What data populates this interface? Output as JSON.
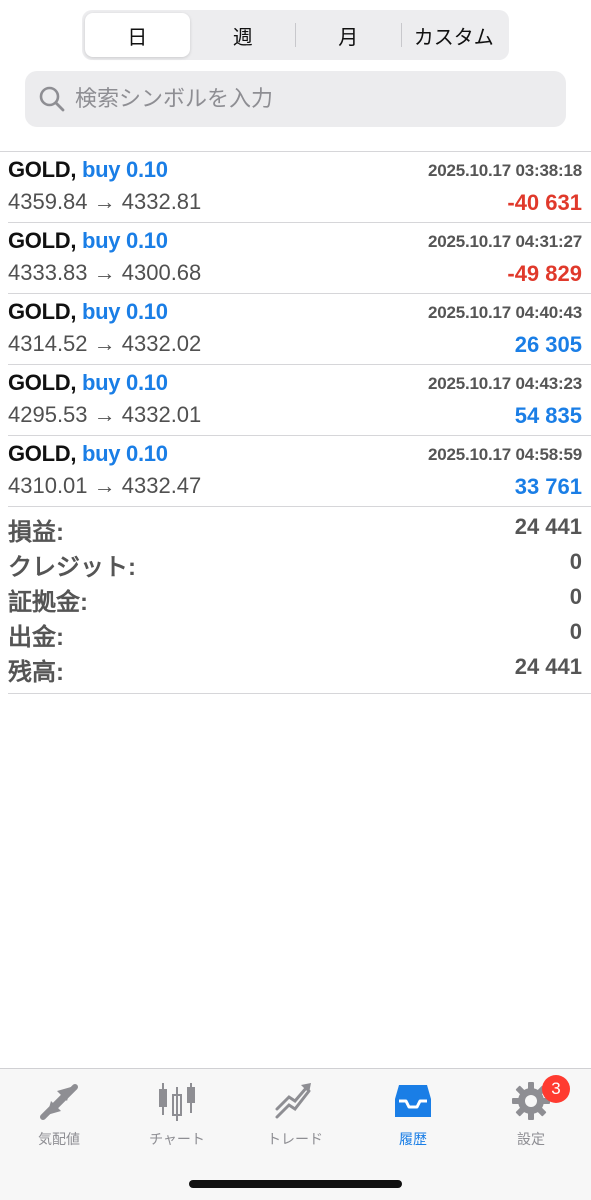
{
  "period_tabs": [
    "日",
    "週",
    "月",
    "カスタム"
  ],
  "active_period": "日",
  "search": {
    "placeholder": "検索シンボルを入力"
  },
  "deals": [
    {
      "symbol": "GOLD,",
      "side": "buy 0.10",
      "time": "2025.10.17 03:38:18",
      "prices": "4359.84 → 4332.81",
      "profit": "-40 631",
      "profit_sign": "neg"
    },
    {
      "symbol": "GOLD,",
      "side": "buy 0.10",
      "time": "2025.10.17 04:31:27",
      "prices": "4333.83 → 4300.68",
      "profit": "-49 829",
      "profit_sign": "neg"
    },
    {
      "symbol": "GOLD,",
      "side": "buy 0.10",
      "time": "2025.10.17 04:40:43",
      "prices": "4314.52 → 4332.02",
      "profit": "26 305",
      "profit_sign": "pos"
    },
    {
      "symbol": "GOLD,",
      "side": "buy 0.10",
      "time": "2025.10.17 04:43:23",
      "prices": "4295.53 → 4332.01",
      "profit": "54 835",
      "profit_sign": "pos"
    },
    {
      "symbol": "GOLD,",
      "side": "buy 0.10",
      "time": "2025.10.17 04:58:59",
      "prices": "4310.01 → 4332.47",
      "profit": "33 761",
      "profit_sign": "pos"
    }
  ],
  "summary": [
    {
      "label": "損益:",
      "value": "24 441"
    },
    {
      "label": "クレジット:",
      "value": "0"
    },
    {
      "label": "証拠金:",
      "value": "0"
    },
    {
      "label": "出金:",
      "value": "0"
    },
    {
      "label": "残高:",
      "value": "24 441"
    }
  ],
  "tabbar": {
    "items": [
      {
        "label": "気配値",
        "icon": "quotes-arrows-icon"
      },
      {
        "label": "チャート",
        "icon": "candlestick-icon"
      },
      {
        "label": "トレード",
        "icon": "trade-trend-icon"
      },
      {
        "label": "履歴",
        "icon": "history-tray-icon"
      },
      {
        "label": "設定",
        "icon": "settings-gear-icon"
      }
    ],
    "active": "履歴",
    "settings_badge": "3"
  },
  "colors": {
    "accent": "#1a7ee6",
    "negative": "#e0392b",
    "badge": "#ff3b30"
  }
}
